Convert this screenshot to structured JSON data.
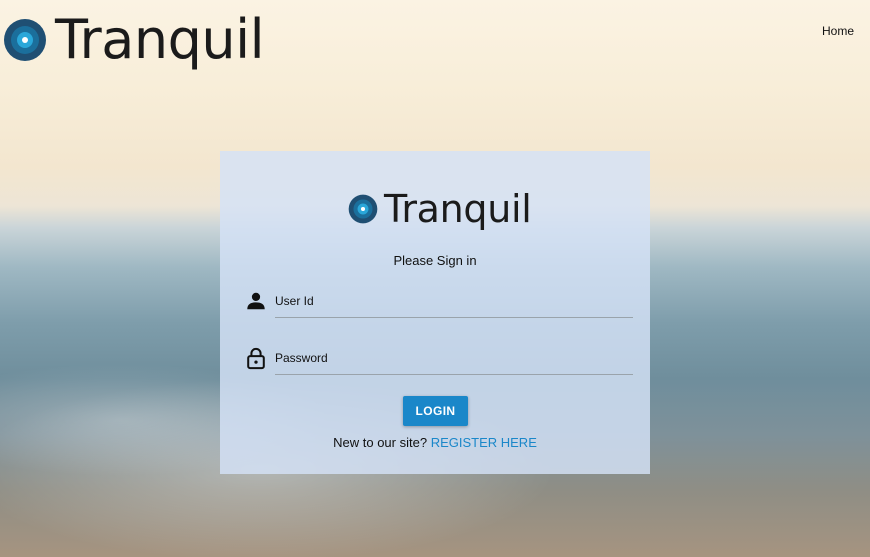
{
  "header": {
    "brand": "Tranquil",
    "nav_home": "Home"
  },
  "login_card": {
    "brand": "Tranquil",
    "title": "Please Sign in",
    "user_placeholder": "User Id",
    "password_placeholder": "Password",
    "login_label": "LOGIN",
    "register_prompt": "New to our site?",
    "register_link": "REGISTER HERE"
  },
  "icons": {
    "logo": "tranquil-logo-icon",
    "user": "person-icon",
    "password": "lock-icon"
  },
  "colors": {
    "accent": "#1a87c9",
    "logo_outer": "#1f4f73",
    "logo_inner": "#2aa7d9"
  }
}
